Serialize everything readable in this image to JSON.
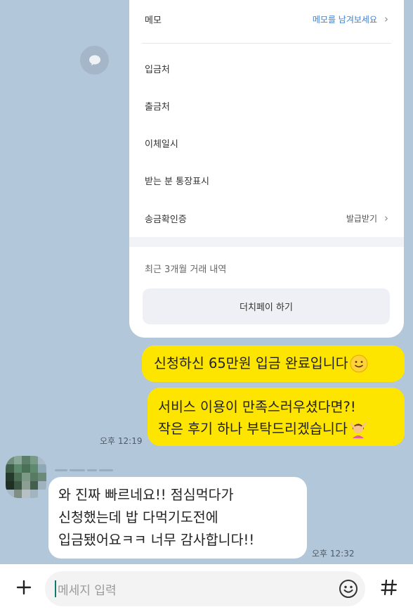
{
  "card": {
    "rows": [
      {
        "label": "메모",
        "value": "메모를 남겨보세요"
      },
      {
        "label": "입금처",
        "value": ""
      },
      {
        "label": "출금처",
        "value": ""
      },
      {
        "label": "이체일시",
        "value": ""
      },
      {
        "label": "받는 분 통장표시",
        "value": ""
      },
      {
        "label": "송금확인증",
        "value": "발급받기"
      }
    ],
    "recent_label": "최근 3개월 거래 내역",
    "dutch_button": "더치페이 하기"
  },
  "messages": {
    "out1": "신청하신 65만원 입금 완료입니다",
    "out2_line1": "서비스 이용이 만족스러우셨다면?!",
    "out2_line2": "작은 후기 하나 부탁드리겠습니다",
    "out_time": "오후 12:19",
    "in_line1": "와 진짜 빠르네요!! 점심먹다가",
    "in_line2": "신청했는데 밥 다먹기도전에",
    "in_line3": "입금됐어요ㅋㅋ 너무 감사합니다!!",
    "in_time": "오후 12:32"
  },
  "input": {
    "placeholder": "메세지 입력"
  },
  "icons": {
    "share": "speech-bubble-icon",
    "plus": "plus-icon",
    "emoji": "emoji-icon",
    "hash": "hash-icon"
  },
  "colors": {
    "chat_bg": "#b2c7da",
    "outgoing_bubble": "#fee500",
    "incoming_bubble": "#ffffff",
    "link": "#3d7fd0"
  }
}
